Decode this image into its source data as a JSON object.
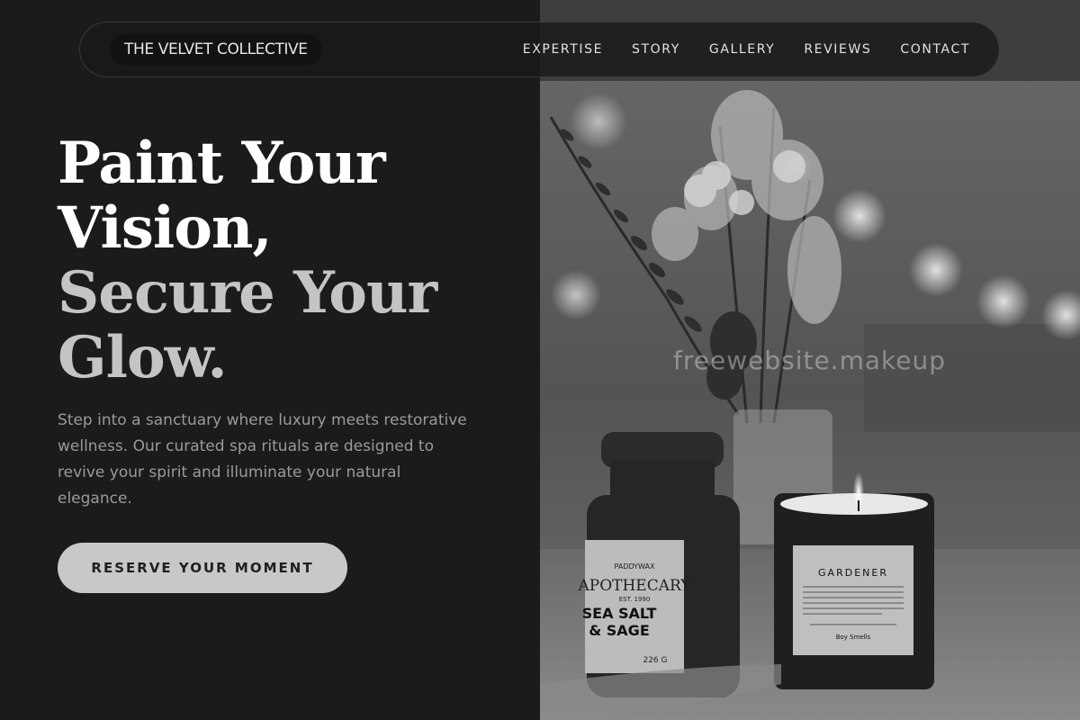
{
  "brand": {
    "name": "THE VELVET COLLECTIVE"
  },
  "nav": {
    "items": [
      {
        "label": "EXPERTISE"
      },
      {
        "label": "STORY"
      },
      {
        "label": "GALLERY"
      },
      {
        "label": "REVIEWS"
      },
      {
        "label": "CONTACT"
      }
    ]
  },
  "hero": {
    "headline_line1": "Paint Your",
    "headline_line2": "Vision,",
    "headline_line3": "Secure Your",
    "headline_line4": "Glow.",
    "description": "Step into a sanctuary where luxury meets restorative wellness. Our curated spa rituals are designed to revive your spirit and illuminate your natural elegance.",
    "cta_label": "RESERVE YOUR MOMENT"
  },
  "photo": {
    "jar_label_brand": "PADDYWAX",
    "jar_label_title": "APOTHECARY",
    "jar_label_est": "EST. 1990",
    "jar_label_scent_1": "SEA SALT",
    "jar_label_scent_2": "& SAGE",
    "jar_label_weight": "226 G",
    "candle_label_title": "GARDENER",
    "candle_label_brand": "Boy Smells"
  },
  "watermark": "freewebsite.makeup"
}
